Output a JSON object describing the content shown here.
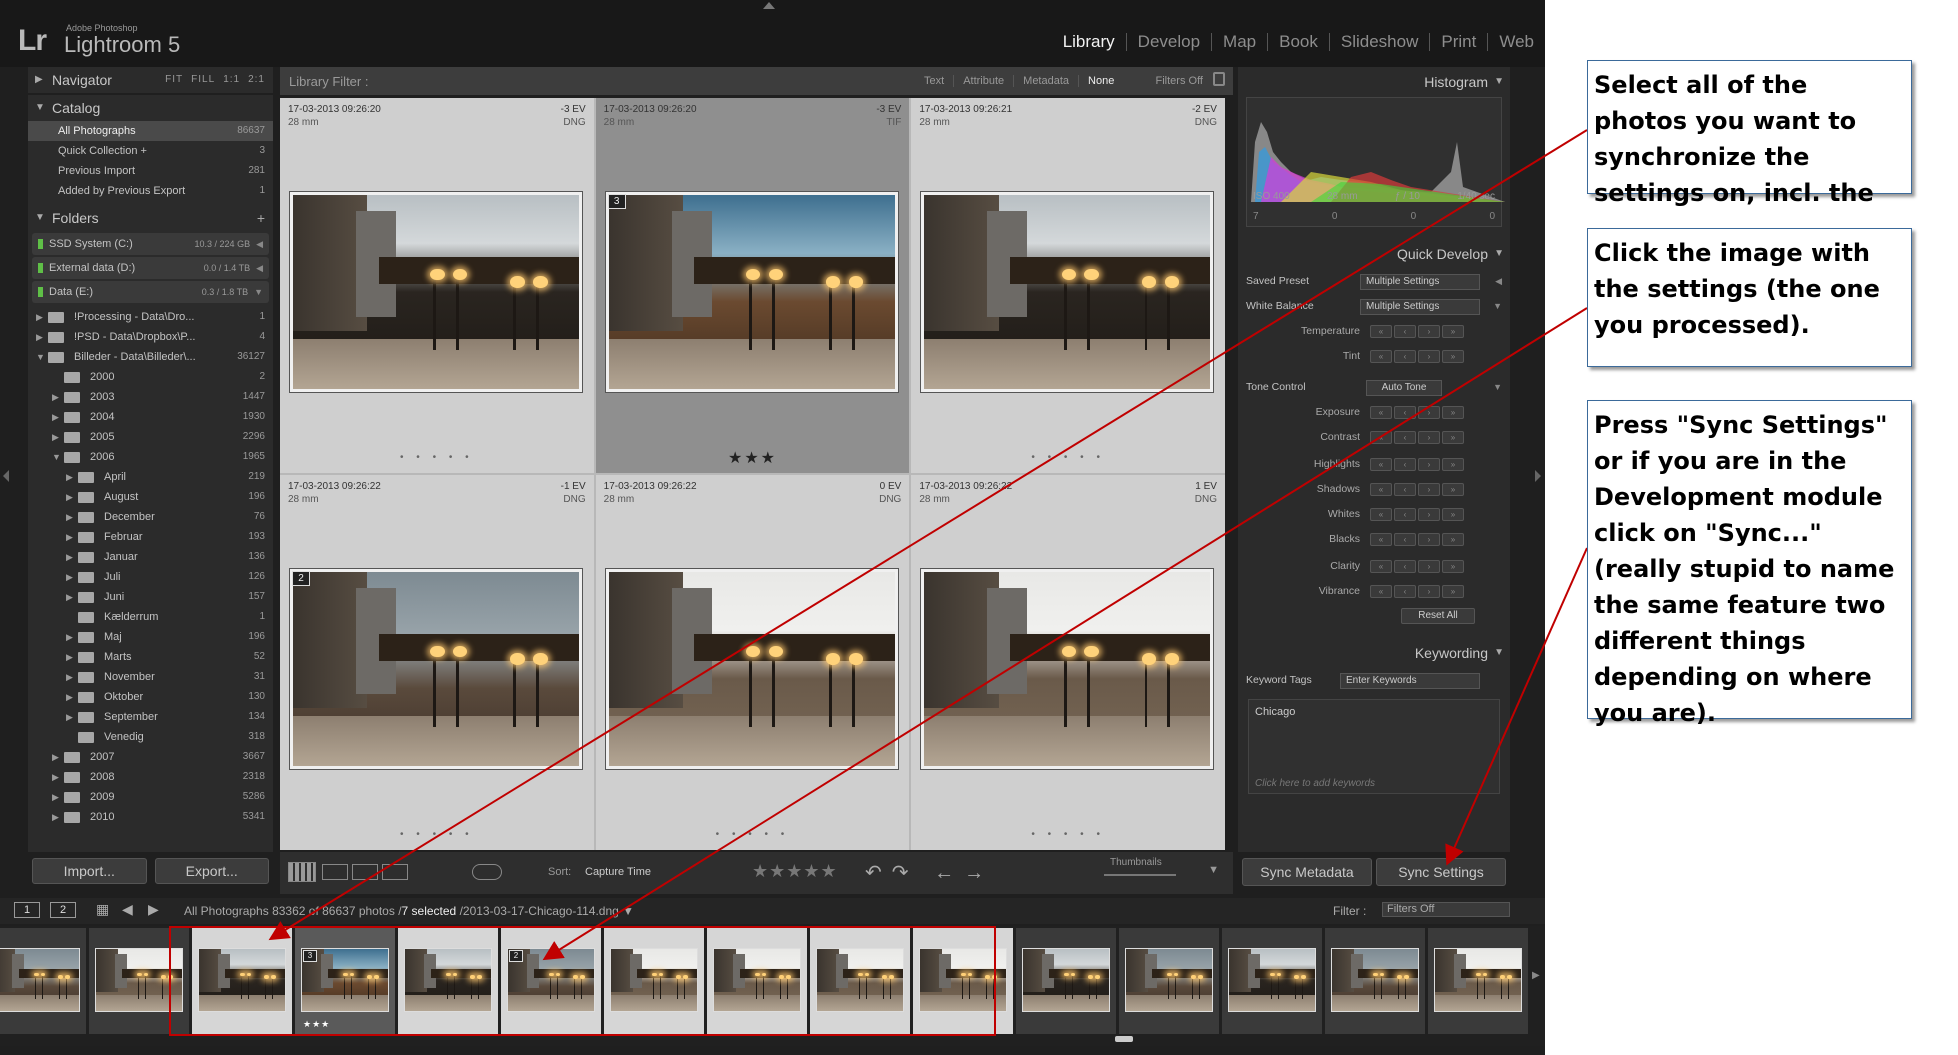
{
  "app": {
    "logo": "Lr",
    "vendor": "Adobe Photoshop",
    "name": "Lightroom 5",
    "modules": [
      "Library",
      "Develop",
      "Map",
      "Book",
      "Slideshow",
      "Print",
      "Web"
    ],
    "active_module": "Library"
  },
  "left_panel": {
    "navigator": {
      "title": "Navigator",
      "zoom": [
        "FIT",
        "FILL",
        "1:1",
        "2:1"
      ]
    },
    "catalog": {
      "title": "Catalog",
      "items": [
        {
          "label": "All Photographs",
          "count": "86637"
        },
        {
          "label": "Quick Collection +",
          "count": "3"
        },
        {
          "label": "Previous Import",
          "count": "281"
        },
        {
          "label": "Added by Previous Export",
          "count": "1"
        }
      ]
    },
    "folders": {
      "title": "Folders",
      "volumes": [
        {
          "name": "SSD System (C:)",
          "size": "10.3 / 224 GB"
        },
        {
          "name": "External data (D:)",
          "size": "0.0 / 1.4 TB"
        },
        {
          "name": "Data (E:)",
          "size": "0.3 / 1.8 TB"
        }
      ],
      "items": [
        {
          "name": "!Processing - Data\\Dro...",
          "count": "1",
          "tri": "▶"
        },
        {
          "name": "!PSD - Data\\Dropbox\\P...",
          "count": "4",
          "tri": "▶"
        },
        {
          "name": "Billeder - Data\\Billeder\\...",
          "count": "36127",
          "tri": "▼"
        },
        {
          "name": "2000",
          "count": "2",
          "tri": ""
        },
        {
          "name": "2003",
          "count": "1447",
          "tri": "▶"
        },
        {
          "name": "2004",
          "count": "1930",
          "tri": "▶"
        },
        {
          "name": "2005",
          "count": "2296",
          "tri": "▶"
        },
        {
          "name": "2006",
          "count": "1965",
          "tri": "▼"
        },
        {
          "name": "April",
          "count": "219",
          "tri": "▶"
        },
        {
          "name": "August",
          "count": "196",
          "tri": "▶"
        },
        {
          "name": "December",
          "count": "76",
          "tri": "▶"
        },
        {
          "name": "Februar",
          "count": "193",
          "tri": "▶"
        },
        {
          "name": "Januar",
          "count": "136",
          "tri": "▶"
        },
        {
          "name": "Juli",
          "count": "126",
          "tri": "▶"
        },
        {
          "name": "Juni",
          "count": "157",
          "tri": "▶"
        },
        {
          "name": "Kælderrum",
          "count": "1",
          "tri": ""
        },
        {
          "name": "Maj",
          "count": "196",
          "tri": "▶"
        },
        {
          "name": "Marts",
          "count": "52",
          "tri": "▶"
        },
        {
          "name": "November",
          "count": "31",
          "tri": "▶"
        },
        {
          "name": "Oktober",
          "count": "130",
          "tri": "▶"
        },
        {
          "name": "September",
          "count": "134",
          "tri": "▶"
        },
        {
          "name": "Venedig",
          "count": "318",
          "tri": ""
        },
        {
          "name": "2007",
          "count": "3667",
          "tri": "▶"
        },
        {
          "name": "2008",
          "count": "2318",
          "tri": "▶"
        },
        {
          "name": "2009",
          "count": "5286",
          "tri": "▶"
        },
        {
          "name": "2010",
          "count": "5341",
          "tri": "▶"
        }
      ]
    },
    "import_label": "Import...",
    "export_label": "Export..."
  },
  "filter_bar": {
    "label": "Library Filter :",
    "options": [
      "Text",
      "Attribute",
      "Metadata",
      "None"
    ],
    "active": "None",
    "preset": "Filters Off"
  },
  "grid": {
    "cells": [
      {
        "date": "17-03-2013 09:26:20",
        "focal": "28 mm",
        "ev": "-3 EV",
        "format": "DNG",
        "badge": "",
        "rating": "",
        "state": "selected",
        "tone": "dark"
      },
      {
        "date": "17-03-2013 09:26:20",
        "focal": "28 mm",
        "ev": "-3 EV",
        "format": "TIF",
        "badge": "3",
        "rating": "★★★",
        "state": "active",
        "tone": "hdr"
      },
      {
        "date": "17-03-2013 09:26:21",
        "focal": "28 mm",
        "ev": "-2 EV",
        "format": "DNG",
        "badge": "",
        "rating": "",
        "state": "selected",
        "tone": "dark"
      },
      {
        "date": "17-03-2013 09:26:22",
        "focal": "28 mm",
        "ev": "-1 EV",
        "format": "DNG",
        "badge": "2",
        "rating": "",
        "state": "selected",
        "tone": "mid"
      },
      {
        "date": "17-03-2013 09:26:22",
        "focal": "28 mm",
        "ev": "0 EV",
        "format": "DNG",
        "badge": "",
        "rating": "",
        "state": "selected",
        "tone": "bright"
      },
      {
        "date": "17-03-2013 09:26:22",
        "focal": "28 mm",
        "ev": "1 EV",
        "format": "DNG",
        "badge": "",
        "rating": "",
        "state": "selected",
        "tone": "bright"
      }
    ],
    "dots": "• • • • •"
  },
  "toolbar": {
    "sort_label": "Sort:",
    "sort_value": "Capture Time",
    "rating": "★★★★★",
    "thumbnails_label": "Thumbnails"
  },
  "right_panel": {
    "histogram": {
      "title": "Histogram",
      "iso": "ISO 400",
      "focal": "28 mm",
      "aperture": "ƒ / 10",
      "shutter": "1/40 sec",
      "counts": [
        "7",
        "0",
        "0",
        "0"
      ]
    },
    "quick_develop": {
      "title": "Quick Develop",
      "saved_preset": {
        "label": "Saved Preset",
        "value": "Multiple Settings"
      },
      "white_balance": {
        "label": "White Balance",
        "value": "Multiple Settings"
      },
      "wb_controls": [
        "Temperature",
        "Tint"
      ],
      "tone_control": {
        "label": "Tone Control",
        "button": "Auto Tone"
      },
      "tone_controls": [
        "Exposure",
        "Contrast",
        "Highlights",
        "Shadows",
        "Whites",
        "Blacks",
        "Clarity",
        "Vibrance"
      ],
      "reset_label": "Reset All"
    },
    "keywording": {
      "title": "Keywording",
      "tags_label": "Keyword Tags",
      "tags_value": "Enter Keywords",
      "keywords": "Chicago",
      "placeholder": "Click here to add keywords"
    },
    "sync_metadata_label": "Sync Metadata",
    "sync_settings_label": "Sync Settings"
  },
  "filmstrip_bar": {
    "page1": "1",
    "page2": "2",
    "source": "All Photographs",
    "summary_pre": "83362 of 86637 photos /",
    "selected": "7 selected",
    "file": "/2013-03-17-Chicago-114.dng",
    "filter_label": "Filter :",
    "filter_value": "Filters Off"
  },
  "filmstrip": {
    "thumbs": [
      {
        "tone": "mid",
        "state": "",
        "badge": "",
        "stars": ""
      },
      {
        "tone": "bright",
        "state": "",
        "badge": "",
        "stars": ""
      },
      {
        "tone": "dark",
        "state": "sel",
        "badge": "",
        "stars": ""
      },
      {
        "tone": "hdr",
        "state": "cur",
        "badge": "3",
        "stars": "★★★"
      },
      {
        "tone": "dark",
        "state": "sel",
        "badge": "",
        "stars": ""
      },
      {
        "tone": "mid",
        "state": "sel",
        "badge": "2",
        "stars": ""
      },
      {
        "tone": "bright",
        "state": "sel",
        "badge": "",
        "stars": ""
      },
      {
        "tone": "bright",
        "state": "sel",
        "badge": "",
        "stars": ""
      },
      {
        "tone": "bright",
        "state": "sel",
        "badge": "",
        "stars": ""
      },
      {
        "tone": "bright",
        "state": "sel",
        "badge": "",
        "stars": ""
      },
      {
        "tone": "dark",
        "state": "",
        "badge": "",
        "stars": ""
      },
      {
        "tone": "mid",
        "state": "",
        "badge": "",
        "stars": ""
      },
      {
        "tone": "dark",
        "state": "",
        "badge": "",
        "stars": ""
      },
      {
        "tone": "mid",
        "state": "",
        "badge": "",
        "stars": ""
      },
      {
        "tone": "bright",
        "state": "",
        "badge": "",
        "stars": ""
      }
    ]
  },
  "annotations": {
    "callout1": "Select all of the photos you want to synchronize the settings on, incl. the",
    "callout2": "Click the image with the settings (the one you processed).",
    "callout3": "Press \"Sync Settings\" or if you are in the Development module click on \"Sync...\" (really stupid to name the same feature two different things depending on where you are).",
    "arrow_color": "#c00000"
  }
}
